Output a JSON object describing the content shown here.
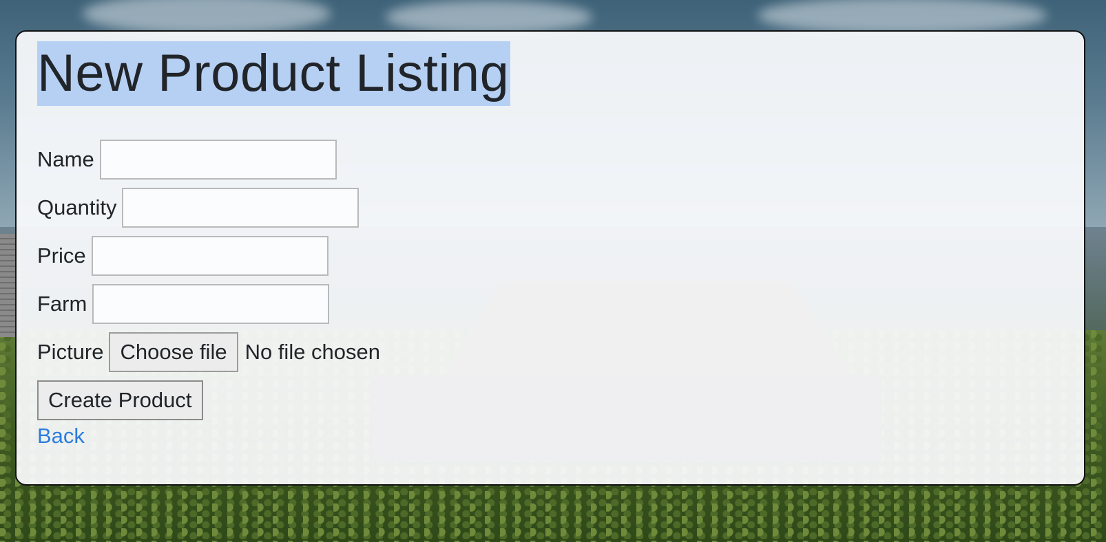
{
  "page": {
    "title": "New Product Listing"
  },
  "form": {
    "name_label": "Name",
    "name_value": "",
    "quantity_label": "Quantity",
    "quantity_value": "",
    "price_label": "Price",
    "price_value": "",
    "farm_label": "Farm",
    "farm_value": "",
    "picture_label": "Picture",
    "choose_file_label": "Choose file",
    "file_status": "No file chosen",
    "submit_label": "Create Product"
  },
  "nav": {
    "back_label": "Back"
  },
  "colors": {
    "title_highlight": "#b6d0f4",
    "link": "#2b7de0",
    "text": "#212529"
  }
}
